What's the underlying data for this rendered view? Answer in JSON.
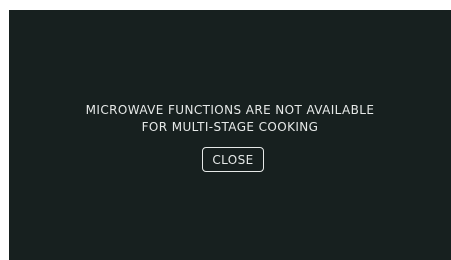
{
  "dialog": {
    "message_line1": "MICROWAVE FUNCTIONS ARE NOT AVAILABLE",
    "message_line2": "FOR MULTI-STAGE COOKING",
    "close_label": "CLOSE"
  },
  "colors": {
    "background": "#17201f",
    "text": "#e6e9e8",
    "button_border": "#e6e9e8"
  }
}
